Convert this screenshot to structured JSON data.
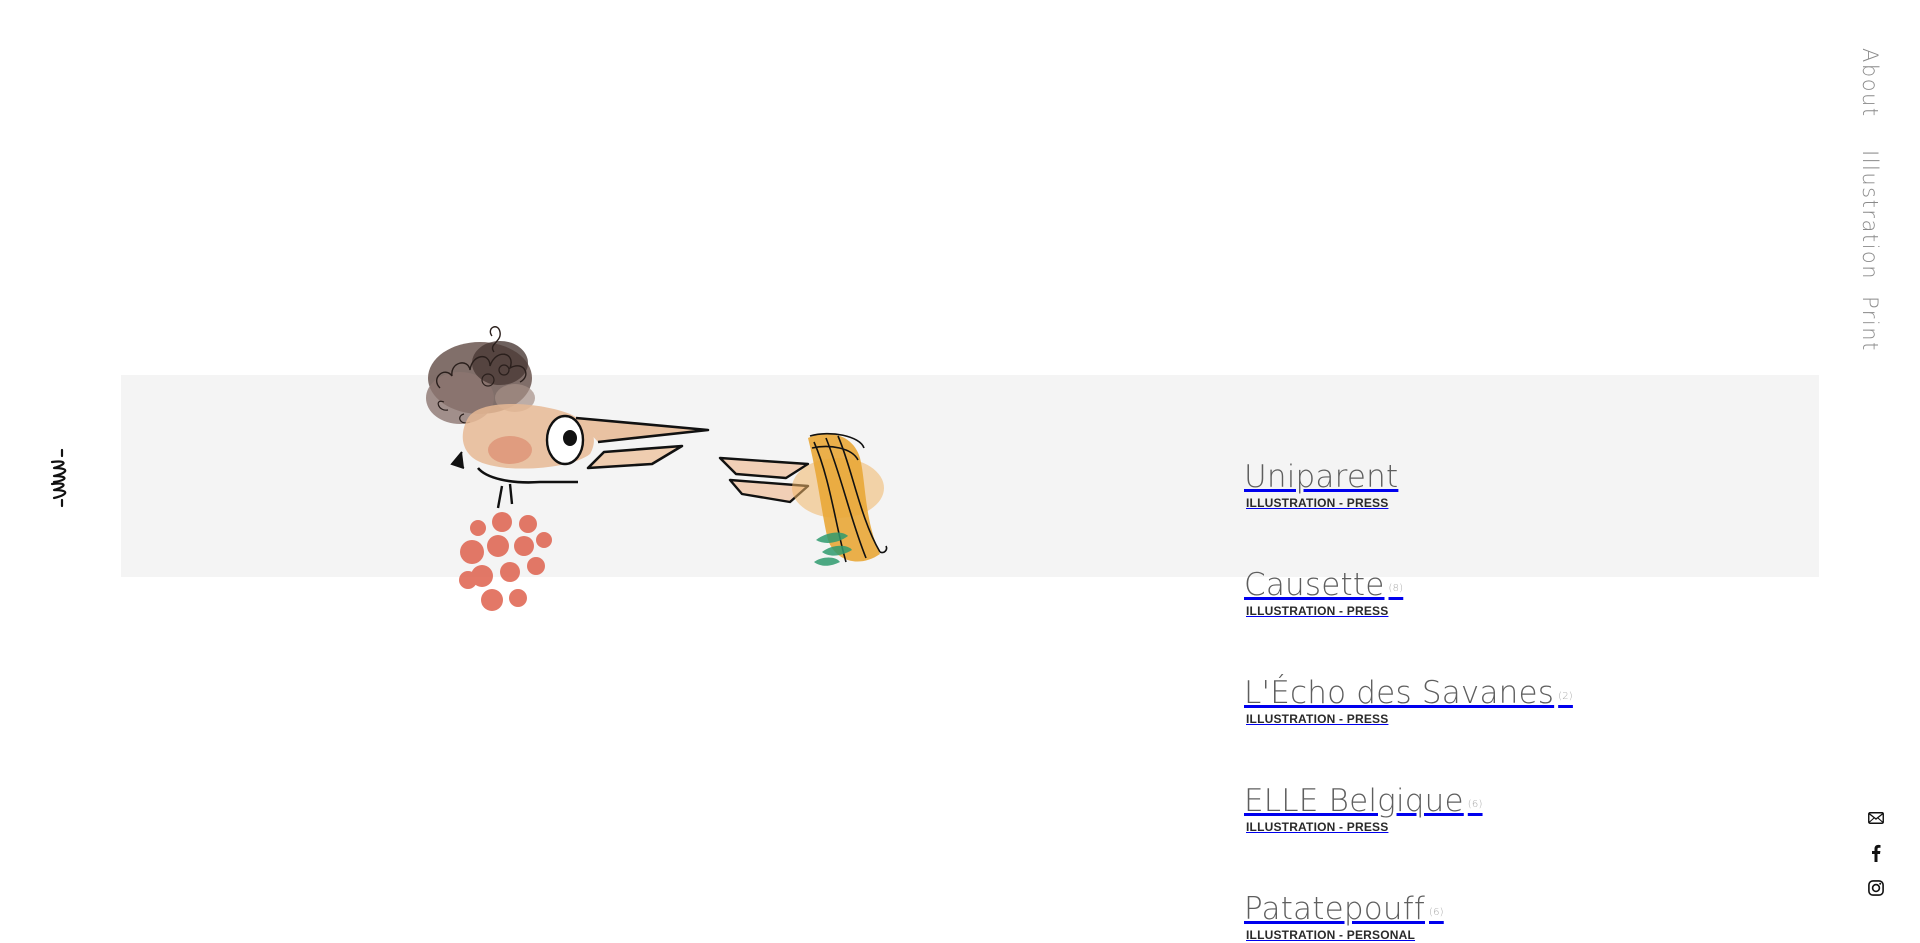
{
  "brand": {
    "logo_icon": "handwritten-signature-logo",
    "logo_text": "-MM-"
  },
  "nav": {
    "items": [
      {
        "label": "About"
      },
      {
        "label": "Illustration"
      },
      {
        "label": "Print"
      }
    ]
  },
  "social": {
    "items": [
      {
        "icon": "mail-icon"
      },
      {
        "icon": "facebook-icon"
      },
      {
        "icon": "instagram-icon"
      }
    ]
  },
  "colors": {
    "band": "#f4f4f4",
    "title_text": "#5e5e5e",
    "category_text": "#2a2a2a",
    "nav_text": "#8a8a8a",
    "count_text": "#a8a8a8"
  },
  "hero": {
    "image": "watercolor-illustration-birds-facing"
  },
  "projects": [
    {
      "title": "Uniparent",
      "count": "",
      "category": "ILLUSTRATION - PRESS"
    },
    {
      "title": "Causette",
      "count": "(8)",
      "category": "ILLUSTRATION - PRESS"
    },
    {
      "title": "L'Écho des Savanes",
      "count": "(2)",
      "category": "ILLUSTRATION - PRESS"
    },
    {
      "title": "ELLE Belgique",
      "count": "(6)",
      "category": "ILLUSTRATION - PRESS"
    },
    {
      "title": "Patatepouff",
      "count": "(6)",
      "category": "ILLUSTRATION - PERSONAL"
    }
  ]
}
